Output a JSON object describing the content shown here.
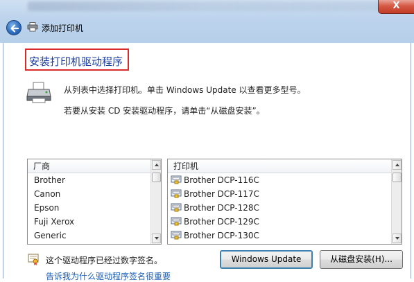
{
  "window": {
    "title": "添加打印机",
    "close_label": "X"
  },
  "page": {
    "heading": "安装打印机驱动程序",
    "info_line1": "从列表中选择打印机。单击 Windows Update 以查看更多型号。",
    "info_line2": "若要从安装 CD 安装驱动程序，请单击“从磁盘安装”。"
  },
  "manufacturers": {
    "header": "厂商",
    "items": [
      "Brother",
      "Canon",
      "Epson",
      "Fuji Xerox",
      "Generic"
    ]
  },
  "printers": {
    "header": "打印机",
    "items": [
      "Brother DCP-116C",
      "Brother DCP-117C",
      "Brother DCP-128C",
      "Brother DCP-129C",
      "Brother DCP-130C"
    ]
  },
  "footer": {
    "signed_text": "这个驱动程序已经过数字签名。",
    "link_text": "告诉我为什么驱动程序签名很重要",
    "windows_update_label": "Windows Update",
    "from_disk_label": "从磁盘安装(H)..."
  },
  "colors": {
    "heading": "#1b3d9e",
    "highlight_border": "#d92b2b",
    "link": "#1a5fb4"
  },
  "icons": [
    "back-arrow-icon",
    "printer-icon",
    "certificate-icon"
  ]
}
